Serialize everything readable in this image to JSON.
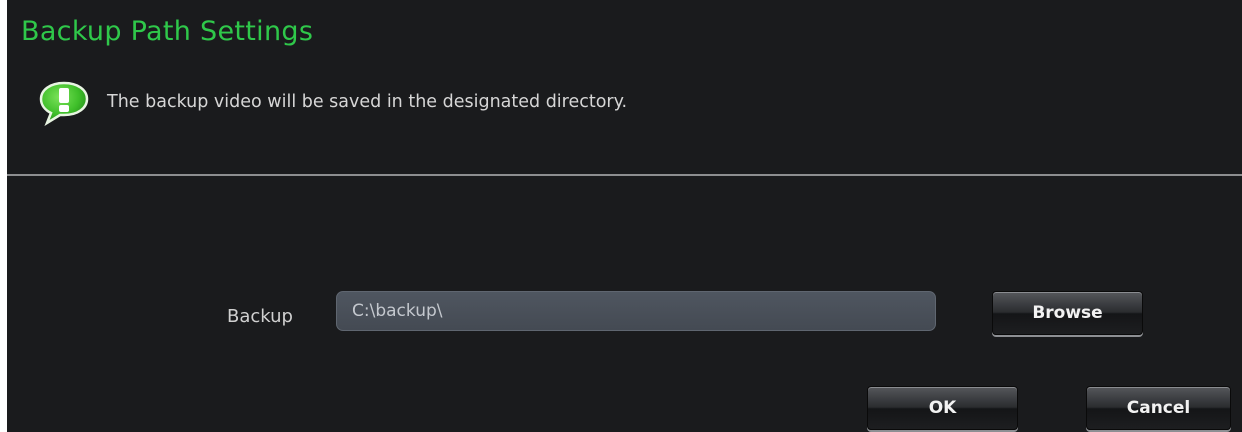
{
  "dialog": {
    "title": "Backup Path Settings",
    "info_icon": "speech-bubble-exclamation-icon",
    "info_text": "The backup video will be saved in the designated directory."
  },
  "form": {
    "backup_label": "Backup",
    "backup_path": "C:\\backup\\",
    "browse_label": "Browse"
  },
  "actions": {
    "ok_label": "OK",
    "cancel_label": "Cancel"
  },
  "colors": {
    "title": "#2fc84a",
    "background": "#1a1b1d",
    "icon_green": "#3fbf2a",
    "divider": "#8d8e90"
  }
}
